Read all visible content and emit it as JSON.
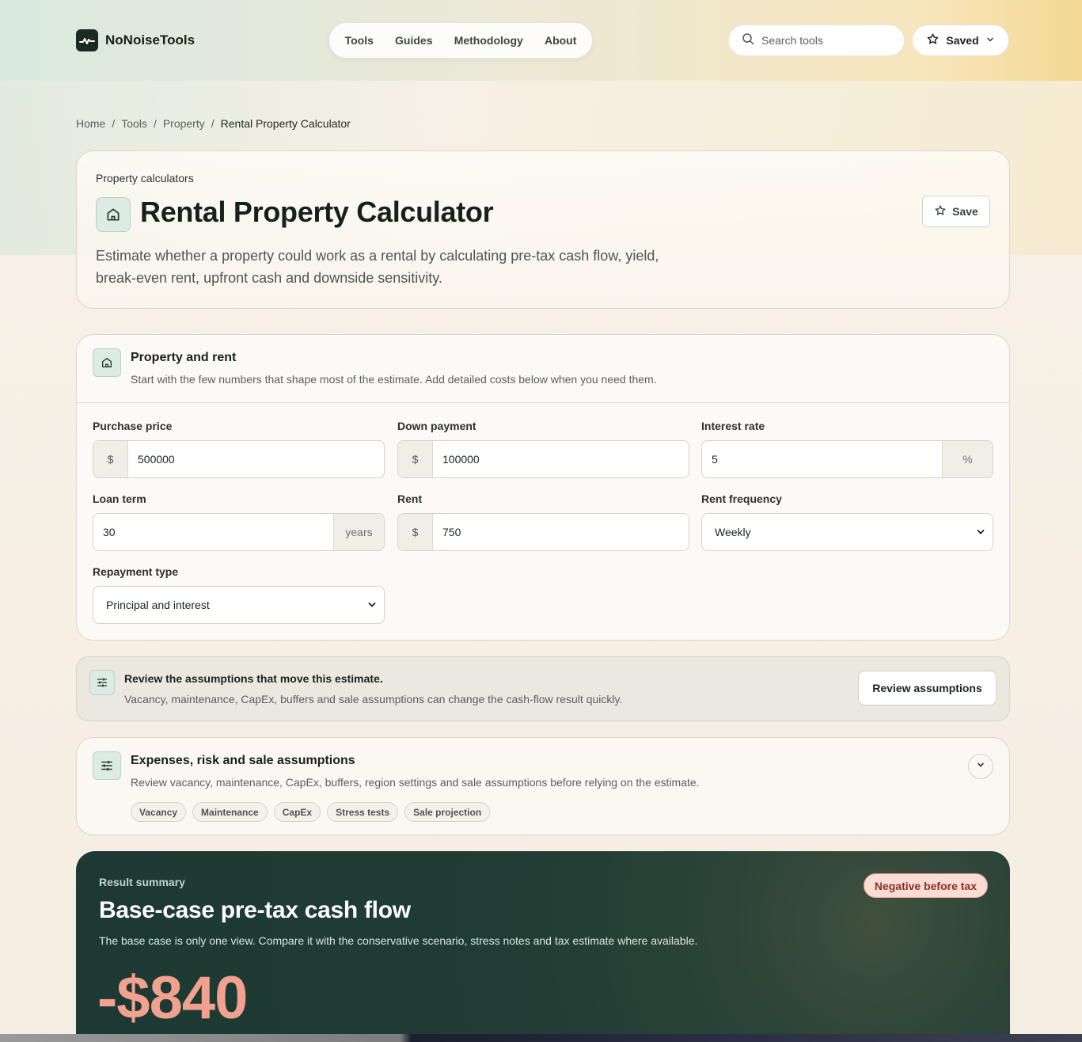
{
  "brand": {
    "name": "NoNoiseTools"
  },
  "nav": {
    "items": [
      "Tools",
      "Guides",
      "Methodology",
      "About"
    ]
  },
  "search": {
    "placeholder": "Search tools"
  },
  "saved": {
    "label": "Saved"
  },
  "breadcrumb": {
    "items": [
      "Home",
      "Tools",
      "Property"
    ],
    "current": "Rental Property Calculator",
    "separator": "/"
  },
  "hero": {
    "eyebrow": "Property calculators",
    "title": "Rental Property Calculator",
    "description": "Estimate whether a property could work as a rental by calculating pre-tax cash flow, yield, break-even rent, upfront cash and downside sensitivity.",
    "save_label": "Save"
  },
  "form": {
    "title": "Property and rent",
    "subtitle": "Start with the few numbers that shape most of the estimate. Add detailed costs below when you need them.",
    "fields": {
      "purchase_price": {
        "label": "Purchase price",
        "prefix": "$",
        "value": "500000"
      },
      "down_payment": {
        "label": "Down payment",
        "prefix": "$",
        "value": "100000"
      },
      "interest_rate": {
        "label": "Interest rate",
        "suffix": "%",
        "value": "5"
      },
      "loan_term": {
        "label": "Loan term",
        "suffix": "years",
        "value": "30"
      },
      "rent": {
        "label": "Rent",
        "prefix": "$",
        "value": "750"
      },
      "rent_frequency": {
        "label": "Rent frequency",
        "value": "Weekly"
      },
      "repayment_type": {
        "label": "Repayment type",
        "value": "Principal and interest"
      }
    }
  },
  "assumptions_notice": {
    "title": "Review the assumptions that move this estimate.",
    "subtitle": "Vacancy, maintenance, CapEx, buffers and sale assumptions can change the cash-flow result quickly.",
    "button": "Review assumptions"
  },
  "expenses": {
    "title": "Expenses, risk and sale assumptions",
    "subtitle": "Review vacancy, maintenance, CapEx, buffers, region settings and sale assumptions before relying on the estimate.",
    "chips": [
      "Vacancy",
      "Maintenance",
      "CapEx",
      "Stress tests",
      "Sale projection"
    ]
  },
  "result": {
    "eyebrow": "Result summary",
    "title": "Base-case pre-tax cash flow",
    "subtitle": "The base case is only one view. Compare it with the conservative scenario, stress notes and tax estimate where available.",
    "value": "-$840",
    "badge": "Negative before tax"
  },
  "colors": {
    "accent_dark": "#1c3a33",
    "negative": "#f2a18f",
    "badge_bg": "#f9dcd4",
    "badge_text": "#8c2f22",
    "icon_tint": "#dcebe3"
  }
}
